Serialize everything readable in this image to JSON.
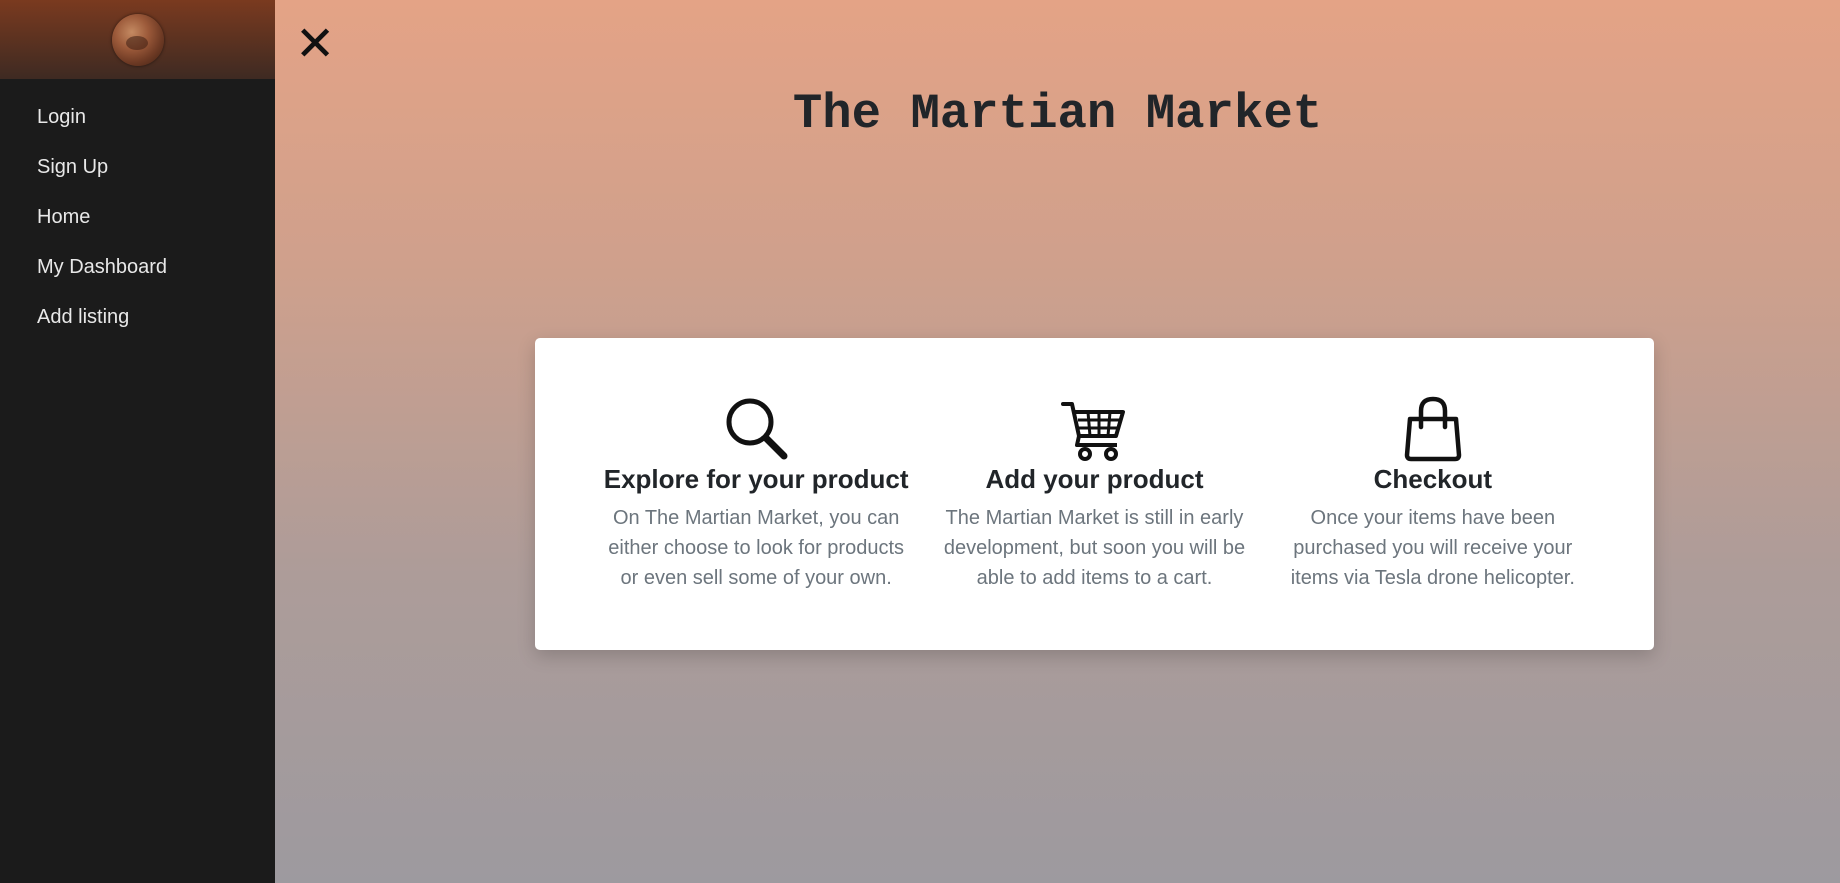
{
  "sidebar": {
    "logo_icon": "mars-planet-icon",
    "items": [
      {
        "label": "Login"
      },
      {
        "label": "Sign Up"
      },
      {
        "label": "Home"
      },
      {
        "label": "My Dashboard"
      },
      {
        "label": "Add listing"
      }
    ]
  },
  "main": {
    "close_icon": "close-icon",
    "close_glyph": "✕",
    "title": "The Martian Market",
    "features": [
      {
        "icon": "search-icon",
        "title": "Explore for your product",
        "description": "On The Martian Market, you can either choose to look for products or even sell some of your own."
      },
      {
        "icon": "cart-icon",
        "title": "Add your product",
        "description": "The Martian Market is still in early development, but soon you will be able to add items to a cart."
      },
      {
        "icon": "shopping-bag-icon",
        "title": "Checkout",
        "description": "Once your items have been purchased you will receive your items via Tesla drone helicopter."
      }
    ]
  },
  "colors": {
    "sidebar_bg": "#1b1b1b",
    "gradient_top": "#e4a386",
    "gradient_bottom": "#9d9a9f",
    "title_text": "#212529",
    "muted_text": "#6c757d"
  }
}
